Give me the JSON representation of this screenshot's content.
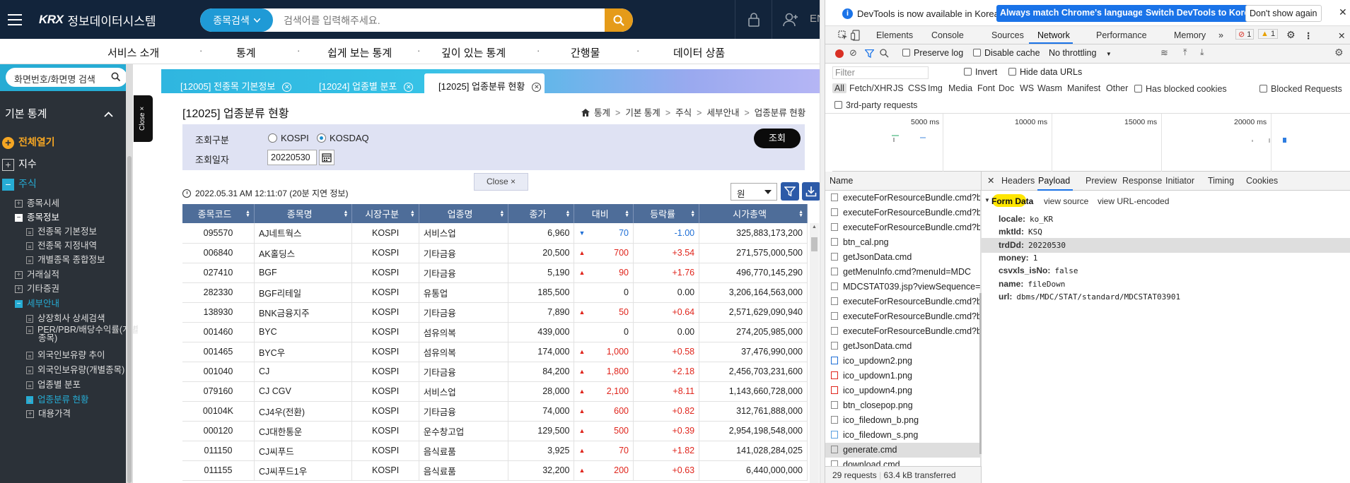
{
  "site": {
    "logo_brand": "KRX",
    "logo_title": "정보데이터시스템",
    "search_type": "종목검색",
    "search_placeholder": "검색어를 입력해주세요.",
    "lang": "EN",
    "gnb": [
      "서비스 소개",
      "통계",
      "쉽게 보는 통계",
      "깊이 있는 통계",
      "간행물",
      "데이터 상품"
    ],
    "sidebar": {
      "search_label": "화면번호/화면명 검색",
      "section_title": "기본 통계",
      "expand_all": "전체열기",
      "items": [
        {
          "label": "지수",
          "level": 0,
          "type": "plus"
        },
        {
          "label": "주식",
          "level": 0,
          "type": "minus",
          "active": true
        },
        {
          "label": "종목시세",
          "level": 1,
          "type": "plus"
        },
        {
          "label": "종목정보",
          "level": 1,
          "type": "minus"
        },
        {
          "label": "전종목 기본정보",
          "level": 2,
          "type": "doc"
        },
        {
          "label": "전종목 지정내역",
          "level": 2,
          "type": "doc"
        },
        {
          "label": "개별종목 종합정보",
          "level": 2,
          "type": "doc"
        },
        {
          "label": "거래실적",
          "level": 1,
          "type": "plus"
        },
        {
          "label": "기타증권",
          "level": 1,
          "type": "plus"
        },
        {
          "label": "세부안내",
          "level": 1,
          "type": "minus",
          "active": true
        },
        {
          "label": "상장회사 상세검색",
          "level": 2,
          "type": "doc"
        },
        {
          "label": "PER/PBR/배당수익률(개별",
          "label2": "종목)",
          "level": 2,
          "type": "doc"
        },
        {
          "label": "외국인보유량 추이",
          "level": 2,
          "type": "doc"
        },
        {
          "label": "외국인보유량(개별종목)",
          "level": 2,
          "type": "doc"
        },
        {
          "label": "업종별 분포",
          "level": 2,
          "type": "doc"
        },
        {
          "label": "업종분류 현황",
          "level": 2,
          "type": "doc",
          "active": true
        },
        {
          "label": "대용가격",
          "level": 2,
          "type": "plus"
        }
      ],
      "close_tab": "Close ×"
    },
    "tabs": [
      {
        "label": "[12005] 전종목 기본정보"
      },
      {
        "label": "[12024] 업종별 분포"
      },
      {
        "label": "[12025] 업종분류 현황",
        "active": true
      }
    ],
    "page_title": "[12025] 업종분류 현황",
    "breadcrumb": [
      "통계",
      "기본 통계",
      "주식",
      "세부안내",
      "업종분류 현황"
    ],
    "filter": {
      "type_label": "조회구분",
      "options": [
        "KOSPI",
        "KOSDAQ"
      ],
      "selected": "KOSDAQ",
      "date_label": "조회일자",
      "date_value": "20220530",
      "search_button": "조회"
    },
    "close_popup": "Close ×",
    "timestamp": "2022.05.31 AM 12:11:07",
    "timestamp_note": "(20분 지연 정보)",
    "currency": "원",
    "table": {
      "headers": [
        "종목코드",
        "종목명",
        "시장구분",
        "업종명",
        "종가",
        "대비",
        "등락률",
        "시가총액"
      ],
      "rows": [
        [
          "095570",
          "AJ네트웍스",
          "KOSPI",
          "서비스업",
          "6,960",
          "70",
          "-1.00",
          "325,883,173,200",
          "down"
        ],
        [
          "006840",
          "AK홀딩스",
          "KOSPI",
          "기타금융",
          "20,500",
          "700",
          "+3.54",
          "271,575,000,500",
          "up"
        ],
        [
          "027410",
          "BGF",
          "KOSPI",
          "기타금융",
          "5,190",
          "90",
          "+1.76",
          "496,770,145,290",
          "up"
        ],
        [
          "282330",
          "BGF리테일",
          "KOSPI",
          "유통업",
          "185,500",
          "0",
          "0.00",
          "3,206,164,563,000",
          "flat"
        ],
        [
          "138930",
          "BNK금융지주",
          "KOSPI",
          "기타금융",
          "7,890",
          "50",
          "+0.64",
          "2,571,629,090,940",
          "up"
        ],
        [
          "001460",
          "BYC",
          "KOSPI",
          "섬유의복",
          "439,000",
          "0",
          "0.00",
          "274,205,985,000",
          "flat"
        ],
        [
          "001465",
          "BYC우",
          "KOSPI",
          "섬유의복",
          "174,000",
          "1,000",
          "+0.58",
          "37,476,990,000",
          "up"
        ],
        [
          "001040",
          "CJ",
          "KOSPI",
          "기타금융",
          "84,200",
          "1,800",
          "+2.18",
          "2,456,703,231,600",
          "up"
        ],
        [
          "079160",
          "CJ CGV",
          "KOSPI",
          "서비스업",
          "28,000",
          "2,100",
          "+8.11",
          "1,143,660,728,000",
          "up"
        ],
        [
          "00104K",
          "CJ4우(전환)",
          "KOSPI",
          "기타금융",
          "74,000",
          "600",
          "+0.82",
          "312,761,888,000",
          "up"
        ],
        [
          "000120",
          "CJ대한통운",
          "KOSPI",
          "운수창고업",
          "129,500",
          "500",
          "+0.39",
          "2,954,198,548,000",
          "up"
        ],
        [
          "011150",
          "CJ씨푸드",
          "KOSPI",
          "음식료품",
          "3,925",
          "70",
          "+1.82",
          "141,028,284,025",
          "up"
        ],
        [
          "011155",
          "CJ씨푸드1우",
          "KOSPI",
          "음식료품",
          "32,200",
          "200",
          "+0.63",
          "6,440,000,000",
          "up"
        ]
      ]
    }
  },
  "devtools": {
    "info_text": "DevTools is now available in Korean!",
    "btn_match": "Always match Chrome's language",
    "btn_switch": "Switch DevTools to Korean",
    "btn_dismiss": "Don't show again",
    "tabs": [
      "Elements",
      "Console",
      "Sources",
      "Network",
      "Performance",
      "Memory"
    ],
    "active_tab": "Network",
    "errors_count": "1",
    "warnings_count": "1",
    "toolbar": {
      "preserve_log": "Preserve log",
      "disable_cache": "Disable cache",
      "throttling": "No throttling"
    },
    "filter_placeholder": "Filter",
    "invert": "Invert",
    "hide_data_urls": "Hide data URLs",
    "types": [
      "All",
      "Fetch/XHR",
      "JS",
      "CSS",
      "Img",
      "Media",
      "Font",
      "Doc",
      "WS",
      "Wasm",
      "Manifest",
      "Other"
    ],
    "has_blocked_cookies": "Has blocked cookies",
    "blocked_requests": "Blocked Requests",
    "third_party": "3rd-party requests",
    "timeline_labels": [
      "5000 ms",
      "10000 ms",
      "15000 ms",
      "20000 ms"
    ],
    "name_header": "Name",
    "requests": [
      "executeForResourceBundle.cmd?b",
      "executeForResourceBundle.cmd?b",
      "executeForResourceBundle.cmd?b",
      "btn_cal.png",
      "getJsonData.cmd",
      "getMenuInfo.cmd?menuId=MDC",
      "MDCSTAT039.jsp?viewSequence=",
      "executeForResourceBundle.cmd?b",
      "executeForResourceBundle.cmd?b",
      "executeForResourceBundle.cmd?b",
      "getJsonData.cmd",
      "ico_updown2.png",
      "ico_updown1.png",
      "ico_updown4.png",
      "btn_closepop.png",
      "ico_filedown_b.png",
      "ico_filedown_s.png",
      "generate.cmd",
      "download.cmd"
    ],
    "selected_request": "generate.cmd",
    "status_requests": "29 requests",
    "status_transferred": "63.4 kB transferred",
    "detail_tabs": [
      "Headers",
      "Payload",
      "Preview",
      "Response",
      "Initiator",
      "Timing",
      "Cookies"
    ],
    "active_detail_tab": "Payload",
    "form_data_title": "Form Data",
    "view_source": "view source",
    "view_url_encoded": "view URL-encoded",
    "form_data": [
      {
        "key": "locale:",
        "value": "ko_KR"
      },
      {
        "key": "mktId:",
        "value": "KSQ"
      },
      {
        "key": "trdDd:",
        "value": "20220530"
      },
      {
        "key": "money:",
        "value": "1"
      },
      {
        "key": "csvxls_isNo:",
        "value": "false"
      },
      {
        "key": "name:",
        "value": "fileDown"
      },
      {
        "key": "url:",
        "value": "dbms/MDC/STAT/standard/MDCSTAT03901"
      }
    ]
  }
}
